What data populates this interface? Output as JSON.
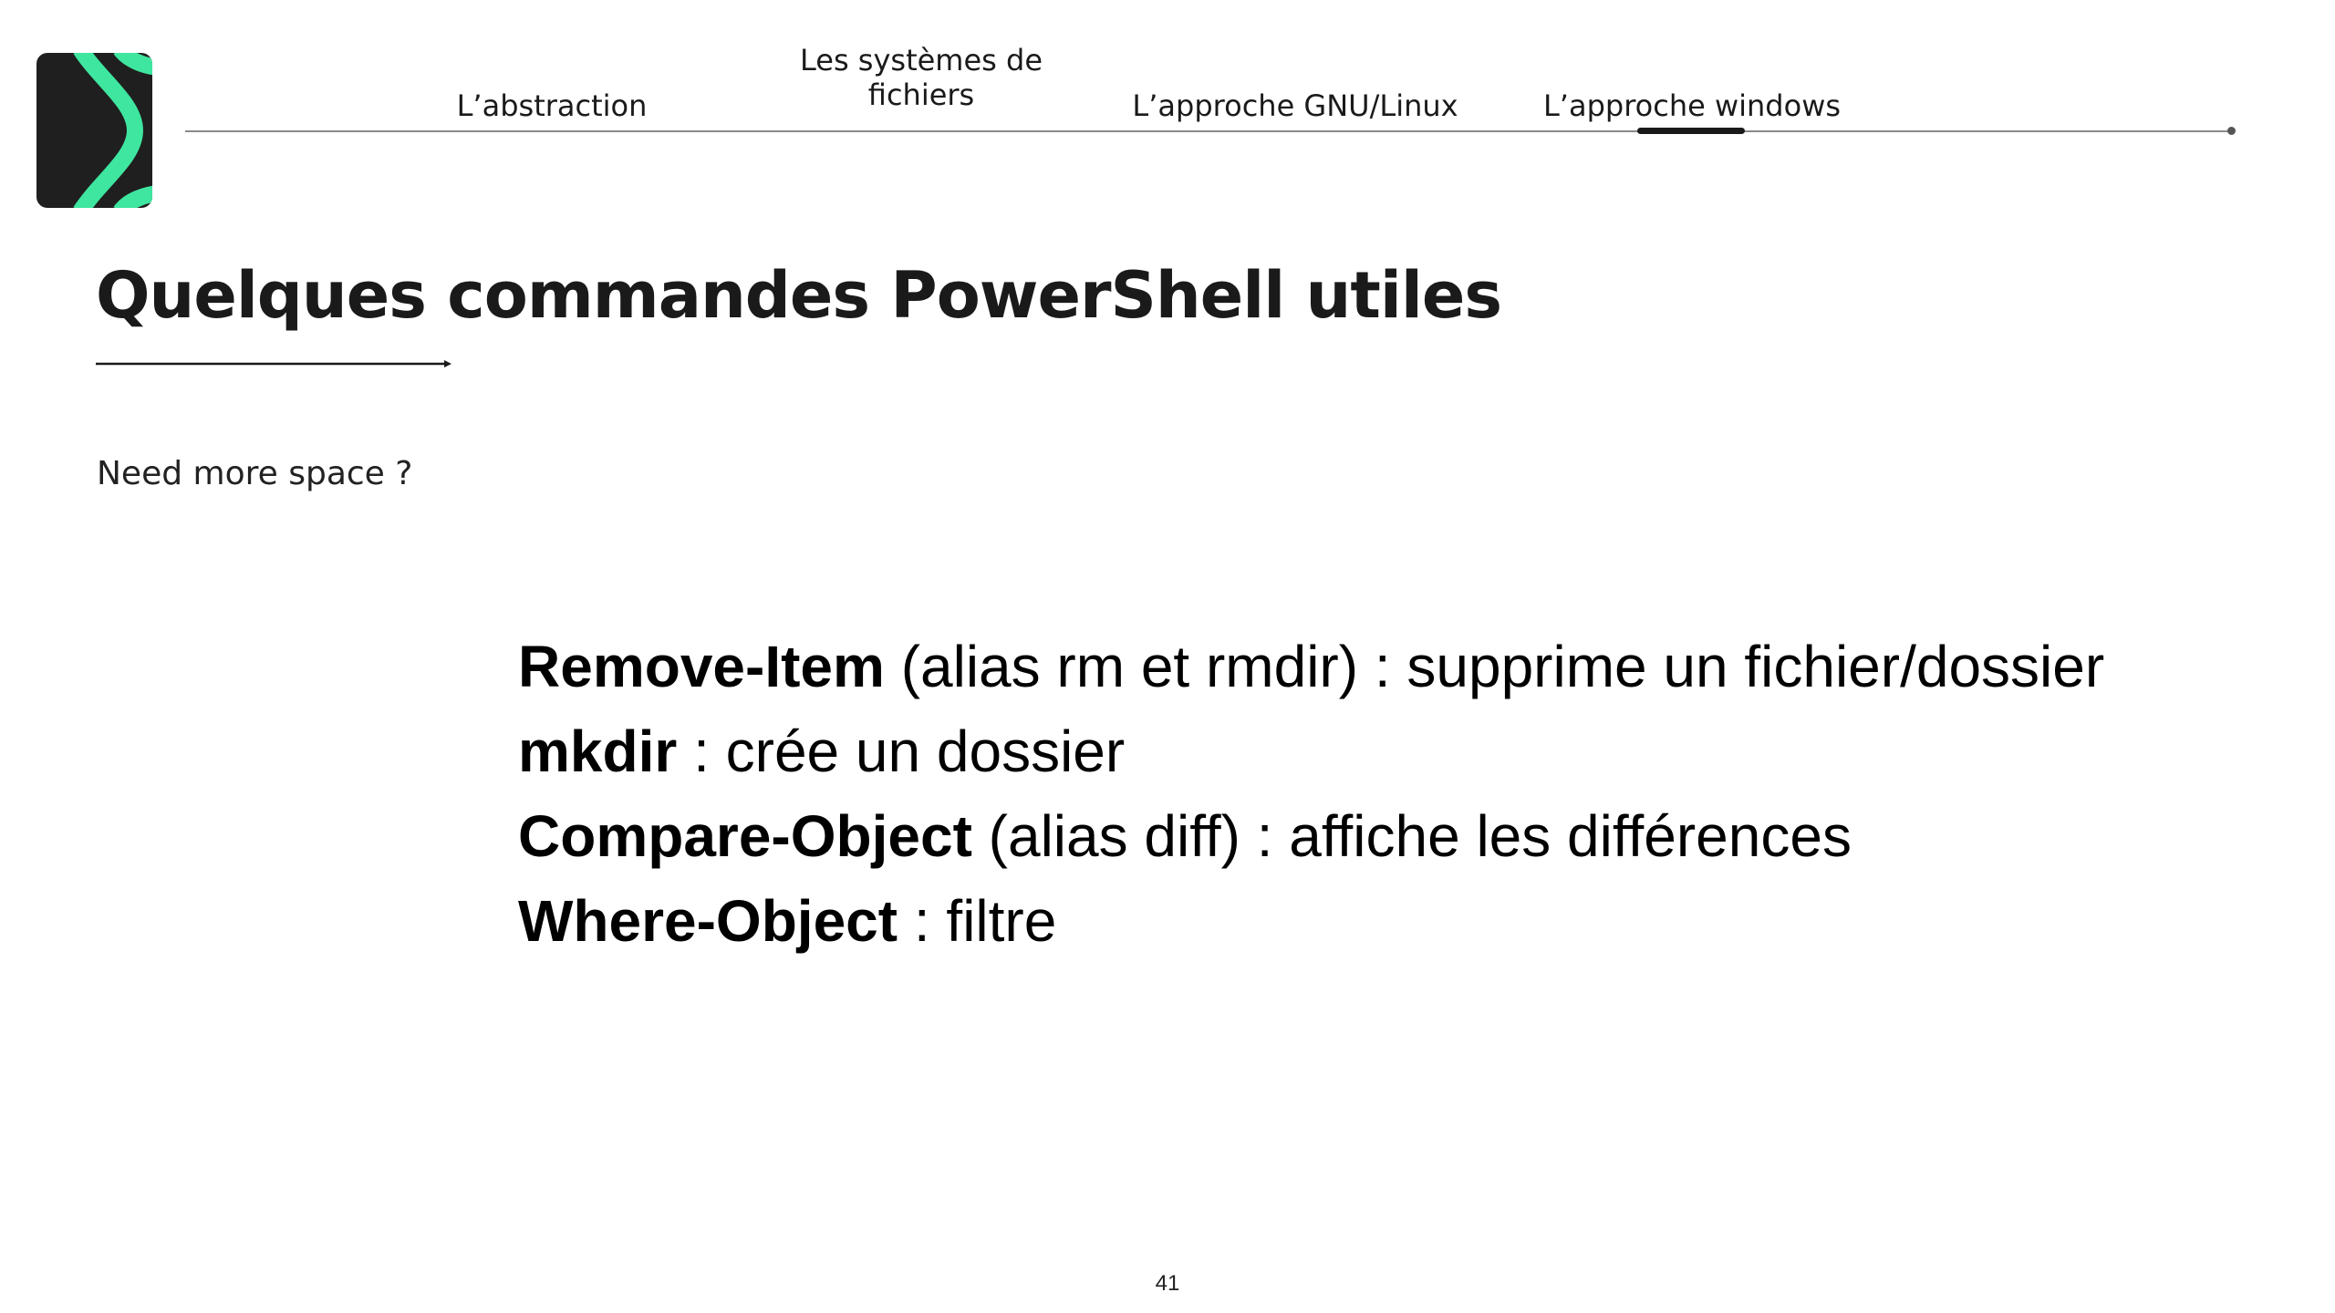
{
  "nav": {
    "items": [
      {
        "label": "L’abstraction"
      },
      {
        "label": "Les systèmes de fichiers"
      },
      {
        "label": "L’approche GNU/Linux"
      },
      {
        "label": "L’approche windows"
      }
    ],
    "active_index": 3
  },
  "logo": {
    "icon": "brand-logo-icon",
    "colors": {
      "background": "#1f1f1f",
      "accent": "#3fe6a0"
    }
  },
  "page": {
    "title": "Quelques commandes PowerShell utiles",
    "subtitle": "Need more space ?",
    "number": "41"
  },
  "commands": [
    {
      "name": "Remove-Item",
      "description": " (alias rm et rmdir) : supprime un fichier/dossier"
    },
    {
      "name": "mkdir",
      "description": " : crée un dossier"
    },
    {
      "name": "Compare-Object",
      "description": " (alias diff) : affiche les différences"
    },
    {
      "name": "Where-Object",
      "description": " : filtre"
    }
  ]
}
